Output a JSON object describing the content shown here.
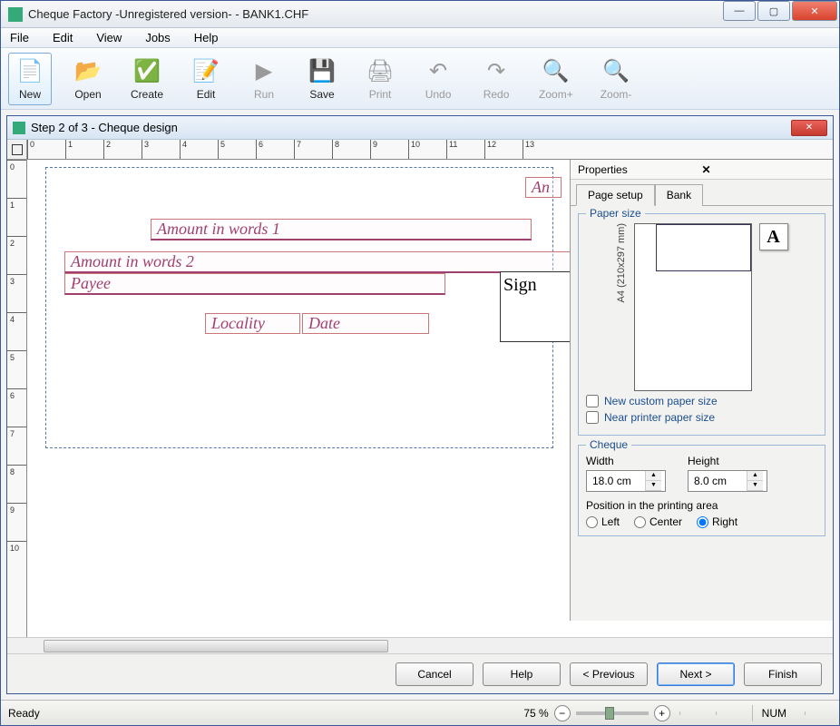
{
  "window": {
    "title": "Cheque Factory -Unregistered version- - BANK1.CHF"
  },
  "menu": [
    "File",
    "Edit",
    "View",
    "Jobs",
    "Help"
  ],
  "toolbar": [
    {
      "id": "new",
      "label": "New",
      "icon": "📄",
      "active": true
    },
    {
      "id": "open",
      "label": "Open",
      "icon": "📂"
    },
    {
      "id": "create",
      "label": "Create",
      "icon": "✅"
    },
    {
      "id": "edit",
      "label": "Edit",
      "icon": "📝"
    },
    {
      "id": "run",
      "label": "Run",
      "icon": "▶",
      "disabled": true
    },
    {
      "id": "save",
      "label": "Save",
      "icon": "💾"
    },
    {
      "id": "print",
      "label": "Print",
      "icon": "🖨",
      "disabled": true
    },
    {
      "id": "undo",
      "label": "Undo",
      "icon": "↶",
      "disabled": true
    },
    {
      "id": "redo",
      "label": "Redo",
      "icon": "↷",
      "disabled": true
    },
    {
      "id": "zoomin",
      "label": "Zoom+",
      "icon": "🔍",
      "disabled": true
    },
    {
      "id": "zoomout",
      "label": "Zoom-",
      "icon": "🔍",
      "disabled": true
    }
  ],
  "designer": {
    "title": "Step 2 of 3 - Cheque design",
    "ruler_h": [
      "0",
      "1",
      "2",
      "3",
      "4",
      "5",
      "6",
      "7",
      "8",
      "9",
      "10",
      "11",
      "12",
      "13"
    ],
    "ruler_v": [
      "0",
      "1",
      "2",
      "3",
      "4",
      "5",
      "6",
      "7",
      "8",
      "9",
      "10"
    ],
    "fields": {
      "amount_label": "An",
      "words1": "Amount in words 1",
      "words2": "Amount in words 2",
      "payee": "Payee",
      "sign": "Sign",
      "locality": "Locality",
      "date": "Date"
    }
  },
  "properties": {
    "title": "Properties",
    "tabs": {
      "page_setup": "Page setup",
      "bank": "Bank"
    },
    "paper_size_legend": "Paper size",
    "paper_name": "A4 (210x297 mm)",
    "new_custom": "New custom paper size",
    "near_printer": "Near printer paper size",
    "cheque_legend": "Cheque",
    "width_label": "Width",
    "height_label": "Height",
    "width_value": "18.0 cm",
    "height_value": "8.0 cm",
    "position_label": "Position in the printing area",
    "positions": {
      "left": "Left",
      "center": "Center",
      "right": "Right"
    },
    "position_selected": "right",
    "font_btn": "A"
  },
  "dialog_buttons": {
    "cancel": "Cancel",
    "help": "Help",
    "previous": "< Previous",
    "next": "Next >",
    "finish": "Finish"
  },
  "statusbar": {
    "ready": "Ready",
    "zoom": "75 %",
    "num": "NUM"
  }
}
